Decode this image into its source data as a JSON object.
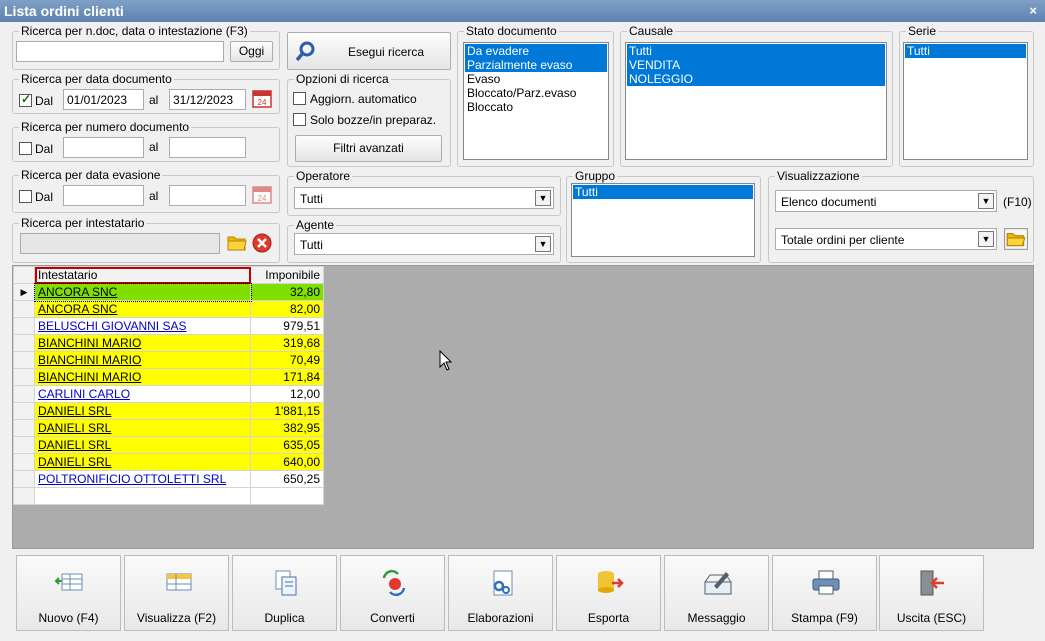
{
  "window": {
    "title": "Lista ordini clienti",
    "close_glyph": "×"
  },
  "search_doc": {
    "legend": "Ricerca per n.doc, data o intestazione (F3)",
    "value": "",
    "today_label": "Oggi"
  },
  "search_button": {
    "label": "Esegui ricerca"
  },
  "date_doc": {
    "legend": "Ricerca per data documento",
    "from_label": "Dal",
    "from_checked": true,
    "from": "01/01/2023",
    "to_label": "al",
    "to": "31/12/2023"
  },
  "options": {
    "legend": "Opzioni di ricerca",
    "auto_update": "Aggiorn. automatico",
    "drafts_only": "Solo bozze/in preparaz.",
    "advanced_filters": "Filtri avanzati"
  },
  "num_doc": {
    "legend": "Ricerca per numero documento",
    "from_label": "Dal",
    "from": "",
    "to_label": "al",
    "to": ""
  },
  "date_evas": {
    "legend": "Ricerca per data evasione",
    "from_label": "Dal",
    "from": "",
    "to_label": "al",
    "to": ""
  },
  "holder": {
    "legend": "Ricerca per intestatario",
    "value": ""
  },
  "stato": {
    "legend": "Stato documento",
    "items": [
      "Da evadere",
      "Parzialmente evaso",
      "Evaso",
      "Bloccato/Parz.evaso",
      "Bloccato"
    ]
  },
  "causale": {
    "legend": "Causale",
    "items": [
      "Tutti",
      "VENDITA",
      "NOLEGGIO"
    ]
  },
  "serie": {
    "legend": "Serie",
    "items": [
      "Tutti"
    ]
  },
  "operatore": {
    "legend": "Operatore",
    "value": "Tutti"
  },
  "agente": {
    "legend": "Agente",
    "value": "Tutti"
  },
  "gruppo": {
    "legend": "Gruppo",
    "items": [
      "Tutti"
    ]
  },
  "visual": {
    "legend": "Visualizzazione",
    "view": "Elenco documenti",
    "hotkey": "(F10)",
    "report": "Totale ordini per cliente"
  },
  "grid": {
    "columns": [
      "Intestatario",
      "Imponibile"
    ],
    "rows": [
      {
        "name": "ANCORA SNC",
        "amount": "32,80",
        "hl": "grn"
      },
      {
        "name": "ANCORA SNC",
        "amount": "82,00",
        "hl": "yel"
      },
      {
        "name": "BELUSCHI GIOVANNI SAS",
        "amount": "979,51",
        "hl": ""
      },
      {
        "name": "BIANCHINI MARIO",
        "amount": "319,68",
        "hl": "yel"
      },
      {
        "name": "BIANCHINI MARIO",
        "amount": "70,49",
        "hl": "yel"
      },
      {
        "name": "BIANCHINI MARIO",
        "amount": "171,84",
        "hl": "yel"
      },
      {
        "name": "CARLINI CARLO",
        "amount": "12,00",
        "hl": ""
      },
      {
        "name": "DANIELI SRL",
        "amount": "1'881,15",
        "hl": "yel"
      },
      {
        "name": "DANIELI SRL",
        "amount": "382,95",
        "hl": "yel"
      },
      {
        "name": "DANIELI SRL",
        "amount": "635,05",
        "hl": "yel"
      },
      {
        "name": "DANIELI SRL",
        "amount": "640,00",
        "hl": "yel"
      },
      {
        "name": "POLTRONIFICIO OTTOLETTI SRL",
        "amount": "650,25",
        "hl": ""
      }
    ]
  },
  "toolbar": {
    "new": "Nuovo (F4)",
    "view": "Visualizza (F2)",
    "duplicate": "Duplica",
    "convert": "Converti",
    "process": "Elaborazioni",
    "export": "Esporta",
    "message": "Messaggio",
    "print": "Stampa (F9)",
    "exit": "Uscita (ESC)"
  },
  "colors": {
    "highlight_yellow": "#ffff00",
    "highlight_green": "#7fe000",
    "selection": "#0078d7",
    "link": "#0000cc"
  }
}
